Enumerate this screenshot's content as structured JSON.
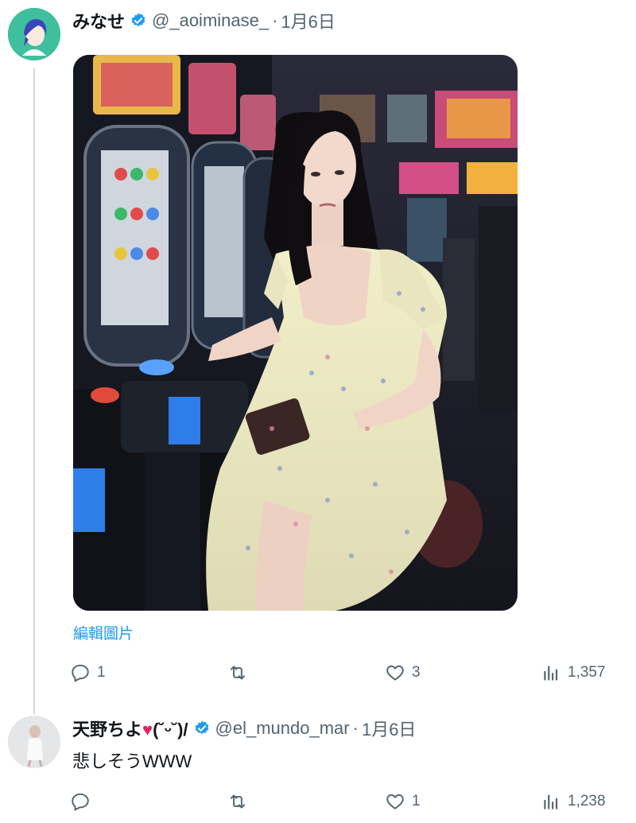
{
  "tweet": {
    "display_name": "みなせ",
    "handle": "@_aoiminase_",
    "separator": "·",
    "date": "1月6日",
    "edit_image_label": "編輯圖片",
    "actions": {
      "replies": "1",
      "retweets": "",
      "likes": "3",
      "views": "1,357"
    }
  },
  "reply": {
    "display_name": "天野ちよ",
    "name_suffix": "(˘ᵕ˘)/",
    "handle": "@el_mundo_mar",
    "separator": "·",
    "date": "1月6日",
    "text": "悲しそうWWW",
    "actions": {
      "replies": "",
      "retweets": "",
      "likes": "1",
      "views": "1,238"
    }
  },
  "icons": {
    "verified": "verified-badge-icon",
    "reply": "reply-bubble-icon",
    "retweet": "retweet-icon",
    "like": "heart-icon",
    "views": "bar-chart-icon"
  },
  "colors": {
    "verified": "#1d9bf0",
    "link": "#1d9bf0",
    "secondary_text": "#536471",
    "thread_line": "#cfd9de",
    "heart_emoji": "#e0245e"
  }
}
